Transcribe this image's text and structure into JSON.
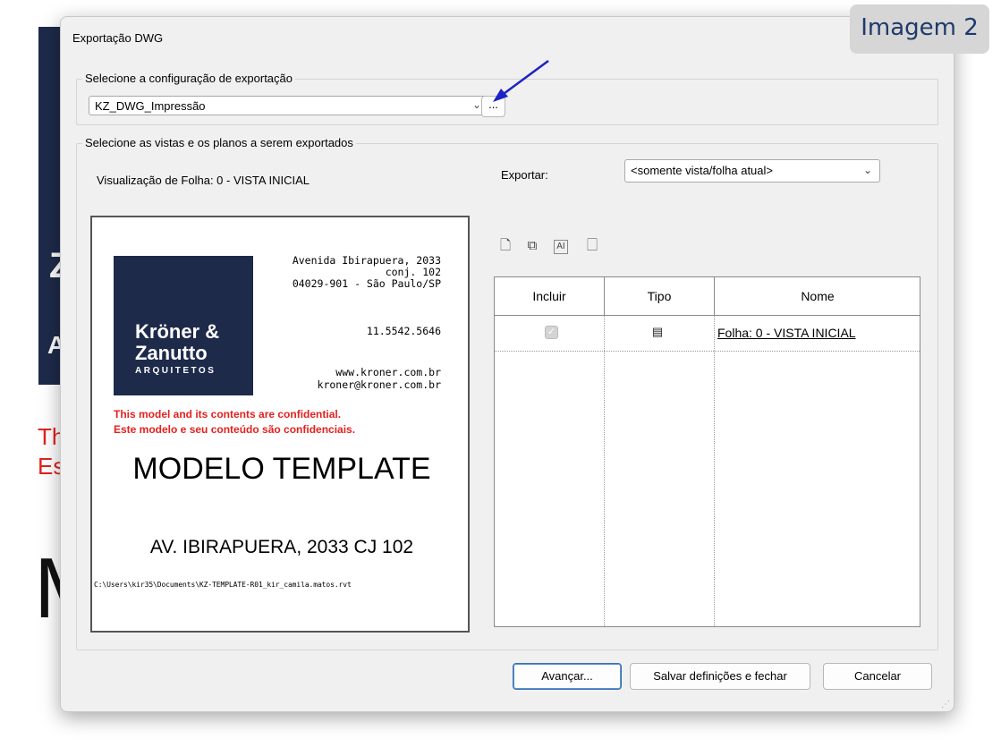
{
  "background": {
    "logo_letters": [
      "",
      "Z",
      "A"
    ],
    "conf_line1": "Thi",
    "conf_line2": "Es",
    "big_letter": "M"
  },
  "badge": "Imagem 2",
  "dialog": {
    "title": "Exportação DWG",
    "config_group": {
      "label": "Selecione a configuração de exportação",
      "selected": "KZ_DWG_Impressão",
      "more_button": "..."
    },
    "views_group": {
      "label": "Selecione as vistas e os planos a serem exportados",
      "preview_label": "Visualização de Folha: 0 - VISTA INICIAL",
      "export_label": "Exportar:",
      "export_selected": "<somente vista/folha atual>"
    },
    "preview_sheet": {
      "logo_line1": "Kröner &",
      "logo_line2": "Zanutto",
      "logo_line3": "ARQUITETOS",
      "address1": "Avenida Ibirapuera, 2033",
      "address2": "conj. 102",
      "address3": "04029-901 - São Paulo/SP",
      "phone": "11.5542.5646",
      "web": "www.kroner.com.br",
      "email": "kroner@kroner.com.br",
      "confidential_en": "This model and its contents are confidential.",
      "confidential_pt": "Este modelo e seu conteúdo são confidenciais.",
      "title": "MODELO TEMPLATE",
      "subtitle": "AV. IBIRAPUERA, 2033 CJ 102",
      "path": "C:\\Users\\kir35\\Documents\\KZ-TEMPLATE-R01_kir_camila.matos.rvt"
    },
    "toolbar_icons": [
      "new-set-icon",
      "duplicate-icon",
      "rename-icon",
      "delete-set-icon"
    ],
    "table": {
      "columns": [
        "Incluir",
        "Tipo",
        "Nome"
      ],
      "rows": [
        {
          "include": true,
          "type_icon": "sheet-icon",
          "name": "Folha: 0 - VISTA INICIAL"
        }
      ]
    },
    "buttons": {
      "next": "Avançar...",
      "save_close": "Salvar definições e fechar",
      "cancel": "Cancelar"
    }
  }
}
